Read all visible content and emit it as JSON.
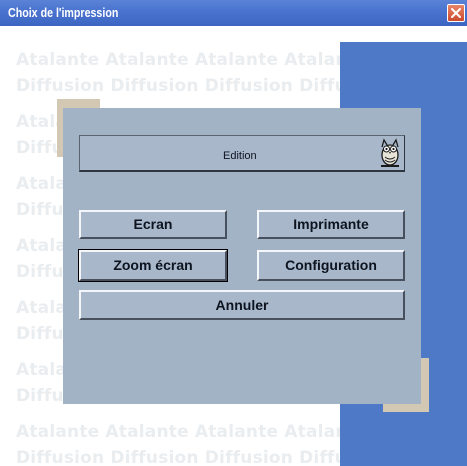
{
  "window": {
    "title": "Choix de l'impression"
  },
  "watermark": {
    "rows": [
      [
        "Atalante",
        "Atalante",
        "Atalante",
        "Atalante"
      ],
      [
        "Diffusion",
        "Diffusion",
        "Diffusion",
        "Diffusion"
      ]
    ]
  },
  "edition": {
    "label": "Edition"
  },
  "buttons": {
    "ecran": "Ecran",
    "imprimante": "Imprimante",
    "zoom_ecran": "Zoom écran",
    "configuration": "Configuration",
    "annuler": "Annuler"
  },
  "icons": {
    "close": "close-icon",
    "owl": "owl-icon"
  },
  "colors": {
    "titlebar": "#4a74cf",
    "dialog": "#a3b3c6",
    "blue_panel": "#4d79c6",
    "beige": "#d2c8b4"
  }
}
